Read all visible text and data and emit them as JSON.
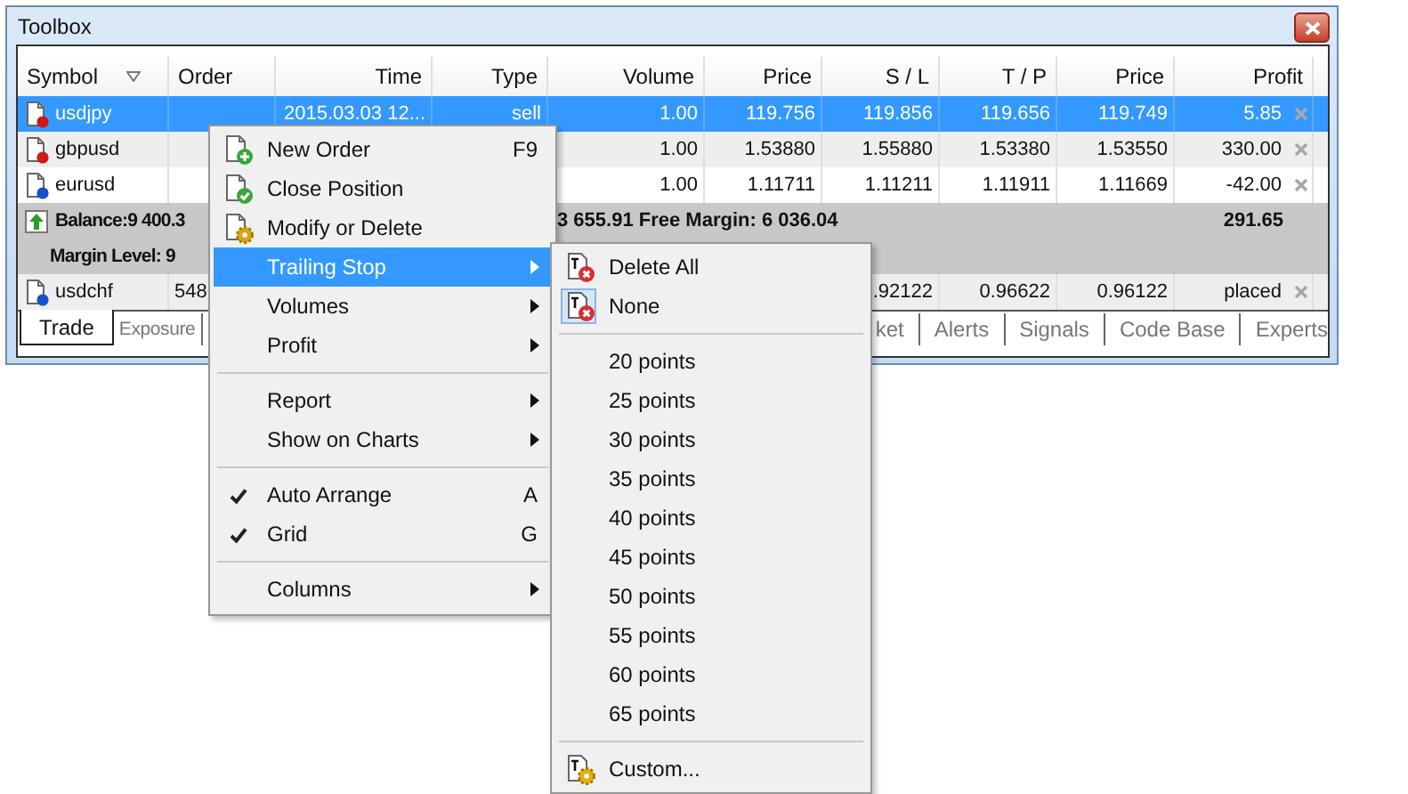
{
  "window": {
    "title": "Toolbox"
  },
  "table": {
    "columns": [
      "Symbol",
      "Order",
      "Time",
      "Type",
      "Volume",
      "Price",
      "S / L",
      "T / P",
      "Price",
      "Profit"
    ],
    "rows": [
      {
        "kind": "position",
        "symbol": "usdjpy",
        "color": "#d01818",
        "selected": true,
        "time": "2015.03.03 12...",
        "type": "sell",
        "volume": "1.00",
        "price": "119.756",
        "sl": "119.856",
        "tp": "119.656",
        "price_now": "119.749",
        "profit": "5.85"
      },
      {
        "kind": "position",
        "symbol": "gbpusd",
        "color": "#d01818",
        "selected": false,
        "volume": "1.00",
        "price": "1.53880",
        "sl": "1.55880",
        "tp": "1.53380",
        "price_now": "1.53550",
        "profit": "330.00"
      },
      {
        "kind": "position",
        "symbol": "eurusd",
        "color": "#1850c8",
        "selected": false,
        "volume": "1.00",
        "price": "1.11711",
        "sl": "1.11211",
        "tp": "1.11911",
        "price_now": "1.11669",
        "profit": "-42.00"
      },
      {
        "kind": "balance",
        "label": "Balance:9 400.3",
        "equity": "3 655.91  Free Margin: 6 036.04",
        "total": "291.65"
      },
      {
        "kind": "margin",
        "label": "Margin Level: 9"
      },
      {
        "kind": "position",
        "symbol": "usdchf",
        "color": "#1850c8",
        "selected": false,
        "order": "548",
        "sl": ".92122",
        "tp": "0.96622",
        "price_now": "0.96122",
        "profit": "placed"
      }
    ]
  },
  "tabs": [
    {
      "label": "Trade",
      "selected": true
    },
    {
      "label": "Exposure",
      "selected": false
    },
    {
      "label": "ket",
      "selected": false
    },
    {
      "label": "Alerts",
      "selected": false
    },
    {
      "label": "Signals",
      "selected": false
    },
    {
      "label": "Code Base",
      "selected": false
    },
    {
      "label": "Experts",
      "selected": false
    }
  ],
  "menus": [
    {
      "items": [
        {
          "kind": "item",
          "label": "New Order",
          "shortcut": "F9",
          "submenu": false,
          "checked": false,
          "selected": false
        },
        {
          "kind": "item",
          "label": "Close Position",
          "submenu": false,
          "checked": false,
          "selected": false
        },
        {
          "kind": "item",
          "label": "Modify or Delete",
          "submenu": false,
          "checked": false,
          "selected": false
        },
        {
          "kind": "item",
          "label": "Trailing Stop",
          "submenu": true,
          "checked": false,
          "selected": true
        },
        {
          "kind": "item",
          "label": "Volumes",
          "submenu": true,
          "checked": false,
          "selected": false
        },
        {
          "kind": "item",
          "label": "Profit",
          "submenu": true,
          "checked": false,
          "selected": false
        },
        {
          "kind": "separator"
        },
        {
          "kind": "item",
          "label": "Report",
          "submenu": true,
          "checked": false,
          "selected": false
        },
        {
          "kind": "item",
          "label": "Show on Charts",
          "submenu": true,
          "checked": false,
          "selected": false
        },
        {
          "kind": "separator"
        },
        {
          "kind": "item",
          "label": "Auto Arrange",
          "shortcut": "A",
          "submenu": false,
          "checked": true,
          "selected": false
        },
        {
          "kind": "item",
          "label": "Grid",
          "shortcut": "G",
          "submenu": false,
          "checked": true,
          "selected": false
        },
        {
          "kind": "separator"
        },
        {
          "kind": "item",
          "label": "Columns",
          "submenu": true,
          "checked": false,
          "selected": false
        }
      ]
    },
    {
      "items": [
        {
          "kind": "item",
          "label": "Delete All",
          "submenu": false,
          "checked": false,
          "selected": false
        },
        {
          "kind": "item",
          "label": "None",
          "submenu": false,
          "checked": true,
          "selected": false
        },
        {
          "kind": "separator"
        },
        {
          "kind": "item",
          "label": "20 points",
          "submenu": false,
          "checked": false,
          "selected": false
        },
        {
          "kind": "item",
          "label": "25 points",
          "submenu": false,
          "checked": false,
          "selected": false
        },
        {
          "kind": "item",
          "label": "30 points",
          "submenu": false,
          "checked": false,
          "selected": false
        },
        {
          "kind": "item",
          "label": "35 points",
          "submenu": false,
          "checked": false,
          "selected": false
        },
        {
          "kind": "item",
          "label": "40 points",
          "submenu": false,
          "checked": false,
          "selected": false
        },
        {
          "kind": "item",
          "label": "45 points",
          "submenu": false,
          "checked": false,
          "selected": false
        },
        {
          "kind": "item",
          "label": "50 points",
          "submenu": false,
          "checked": false,
          "selected": false
        },
        {
          "kind": "item",
          "label": "55 points",
          "submenu": false,
          "checked": false,
          "selected": false
        },
        {
          "kind": "item",
          "label": "60 points",
          "submenu": false,
          "checked": false,
          "selected": false
        },
        {
          "kind": "item",
          "label": "65 points",
          "submenu": false,
          "checked": false,
          "selected": false
        },
        {
          "kind": "separator"
        },
        {
          "kind": "item",
          "label": "Custom...",
          "submenu": false,
          "checked": false,
          "selected": false
        }
      ]
    }
  ]
}
